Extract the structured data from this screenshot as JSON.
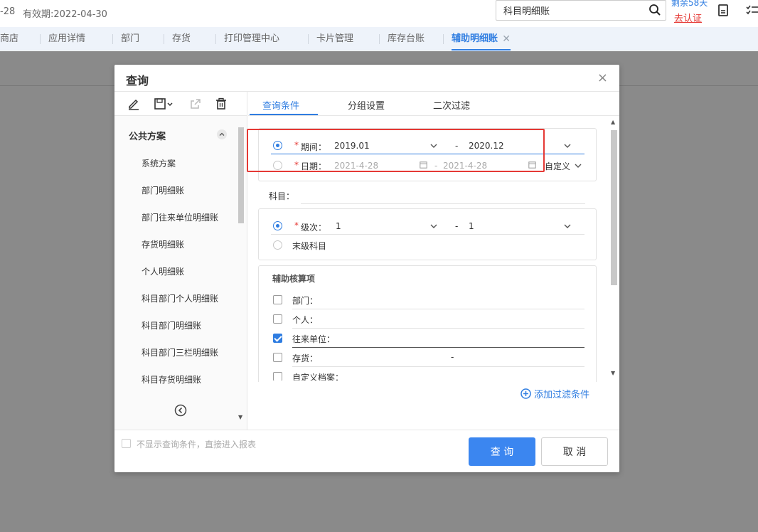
{
  "topbar": {
    "left_fragment": "-28",
    "validity": "有效期:2022-04-30",
    "search_value": "科目明细账",
    "remaining": "剩余58天",
    "certify": "去认证"
  },
  "tabs": [
    {
      "label": "商店"
    },
    {
      "label": "应用详情"
    },
    {
      "label": "部门"
    },
    {
      "label": "存货"
    },
    {
      "label": "打印管理中心"
    },
    {
      "label": "卡片管理"
    },
    {
      "label": "库存台账"
    },
    {
      "label": "辅助明细账",
      "active": true,
      "close": "✕"
    }
  ],
  "dialog": {
    "title": "查询",
    "close": "×",
    "left": {
      "group": "公共方案",
      "items": [
        "系统方案",
        "部门明细账",
        "部门往来单位明细账",
        "存货明细账",
        "个人明细账",
        "科目部门个人明细账",
        "科目部门明细账",
        "科目部门三栏明细账",
        "科目存货明细账"
      ]
    },
    "tabs": [
      "查询条件",
      "分组设置",
      "二次过滤"
    ],
    "conditions": {
      "period": {
        "required": "*",
        "label": "期间：",
        "from": "2019.01",
        "sep": "-",
        "to": "2020.12",
        "selected": true
      },
      "date": {
        "required": "*",
        "label": "日期：",
        "from": "2021-4-28",
        "sep": "-",
        "to": "2021-4-28",
        "mode": "自定义",
        "selected": false
      },
      "subject": {
        "label": "科目："
      },
      "level": {
        "required": "*",
        "label": "级次：",
        "from": "1",
        "sep": "-",
        "to": "1",
        "selected": true
      },
      "leaf": {
        "label": "末级科目",
        "selected": false
      },
      "aux": {
        "title": "辅助核算项",
        "items": [
          {
            "label": "部门：",
            "checked": false,
            "value": ""
          },
          {
            "label": "个人：",
            "checked": false,
            "value": ""
          },
          {
            "label": "往来单位：",
            "checked": true,
            "value": ""
          },
          {
            "label": "存货：",
            "checked": false,
            "value": "-"
          },
          {
            "label": "自定义档案：",
            "checked": false,
            "value": ""
          }
        ]
      }
    },
    "add_filter": "添加过滤条件",
    "footer": {
      "skip_text": "不显示查询条件，直接进入报表",
      "query_btn": "查 询",
      "cancel_btn": "取 消"
    }
  },
  "colors": {
    "accent": "#2f7de1",
    "highlight": "#e53935",
    "overlay": "#8a8a8a"
  }
}
